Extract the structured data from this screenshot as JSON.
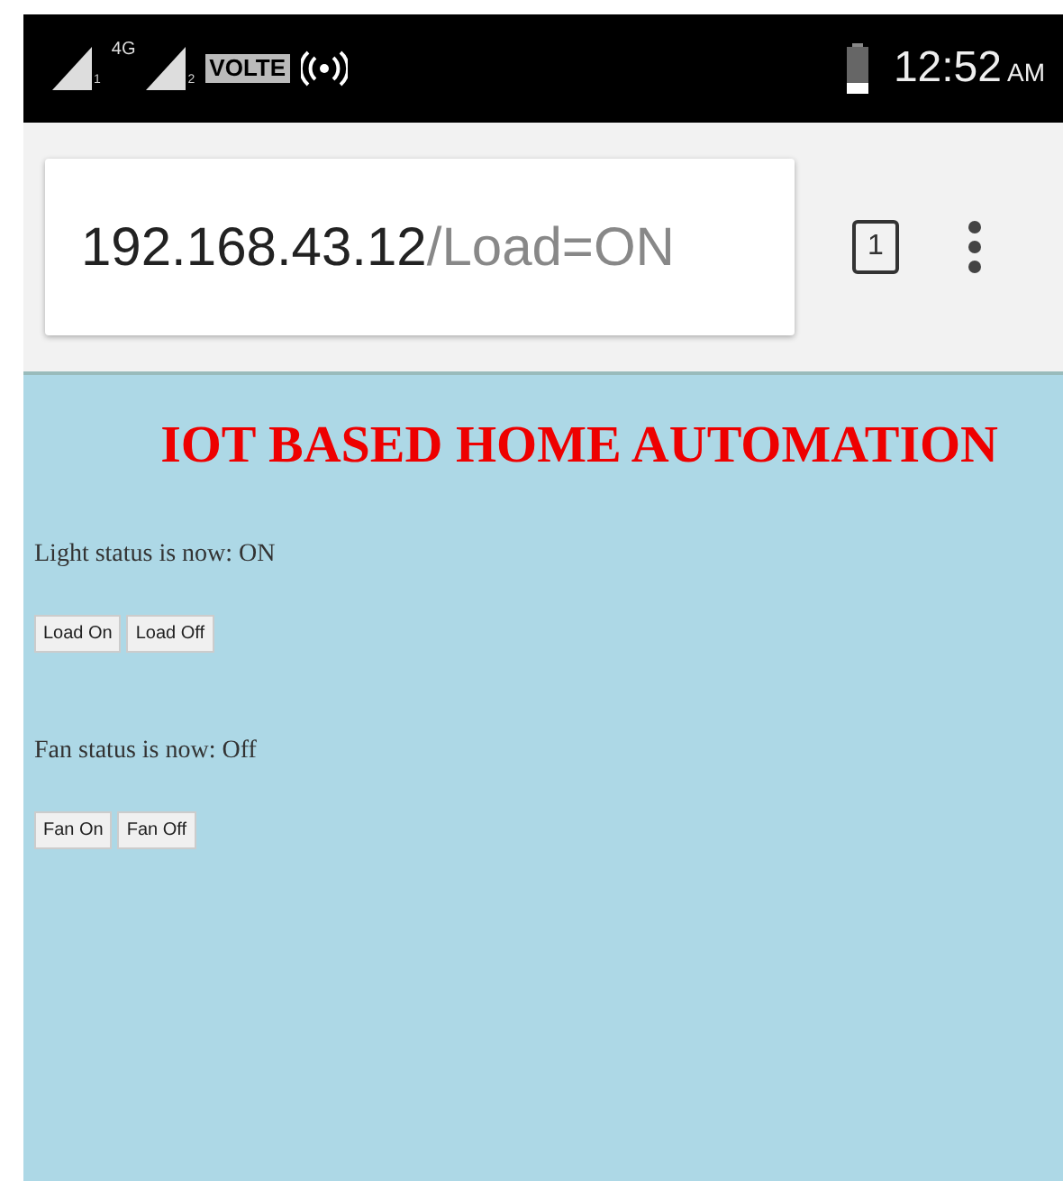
{
  "status_bar": {
    "network_type": "4G",
    "sim_1": "1",
    "sim_2": "2",
    "volte": "VOLTE",
    "time": "12:52",
    "meridiem": "AM"
  },
  "address_bar": {
    "host": "192.168.43.12",
    "path": "/Load=ON",
    "tab_count": "1"
  },
  "page": {
    "title": "IOT BASED HOME AUTOMATION",
    "sections": [
      {
        "status": "Light status is now: ON",
        "buttons": [
          "Load On",
          "Load Off"
        ]
      },
      {
        "status": "Fan status is now: Off",
        "buttons": [
          "Fan On",
          "Fan Off"
        ]
      }
    ]
  }
}
